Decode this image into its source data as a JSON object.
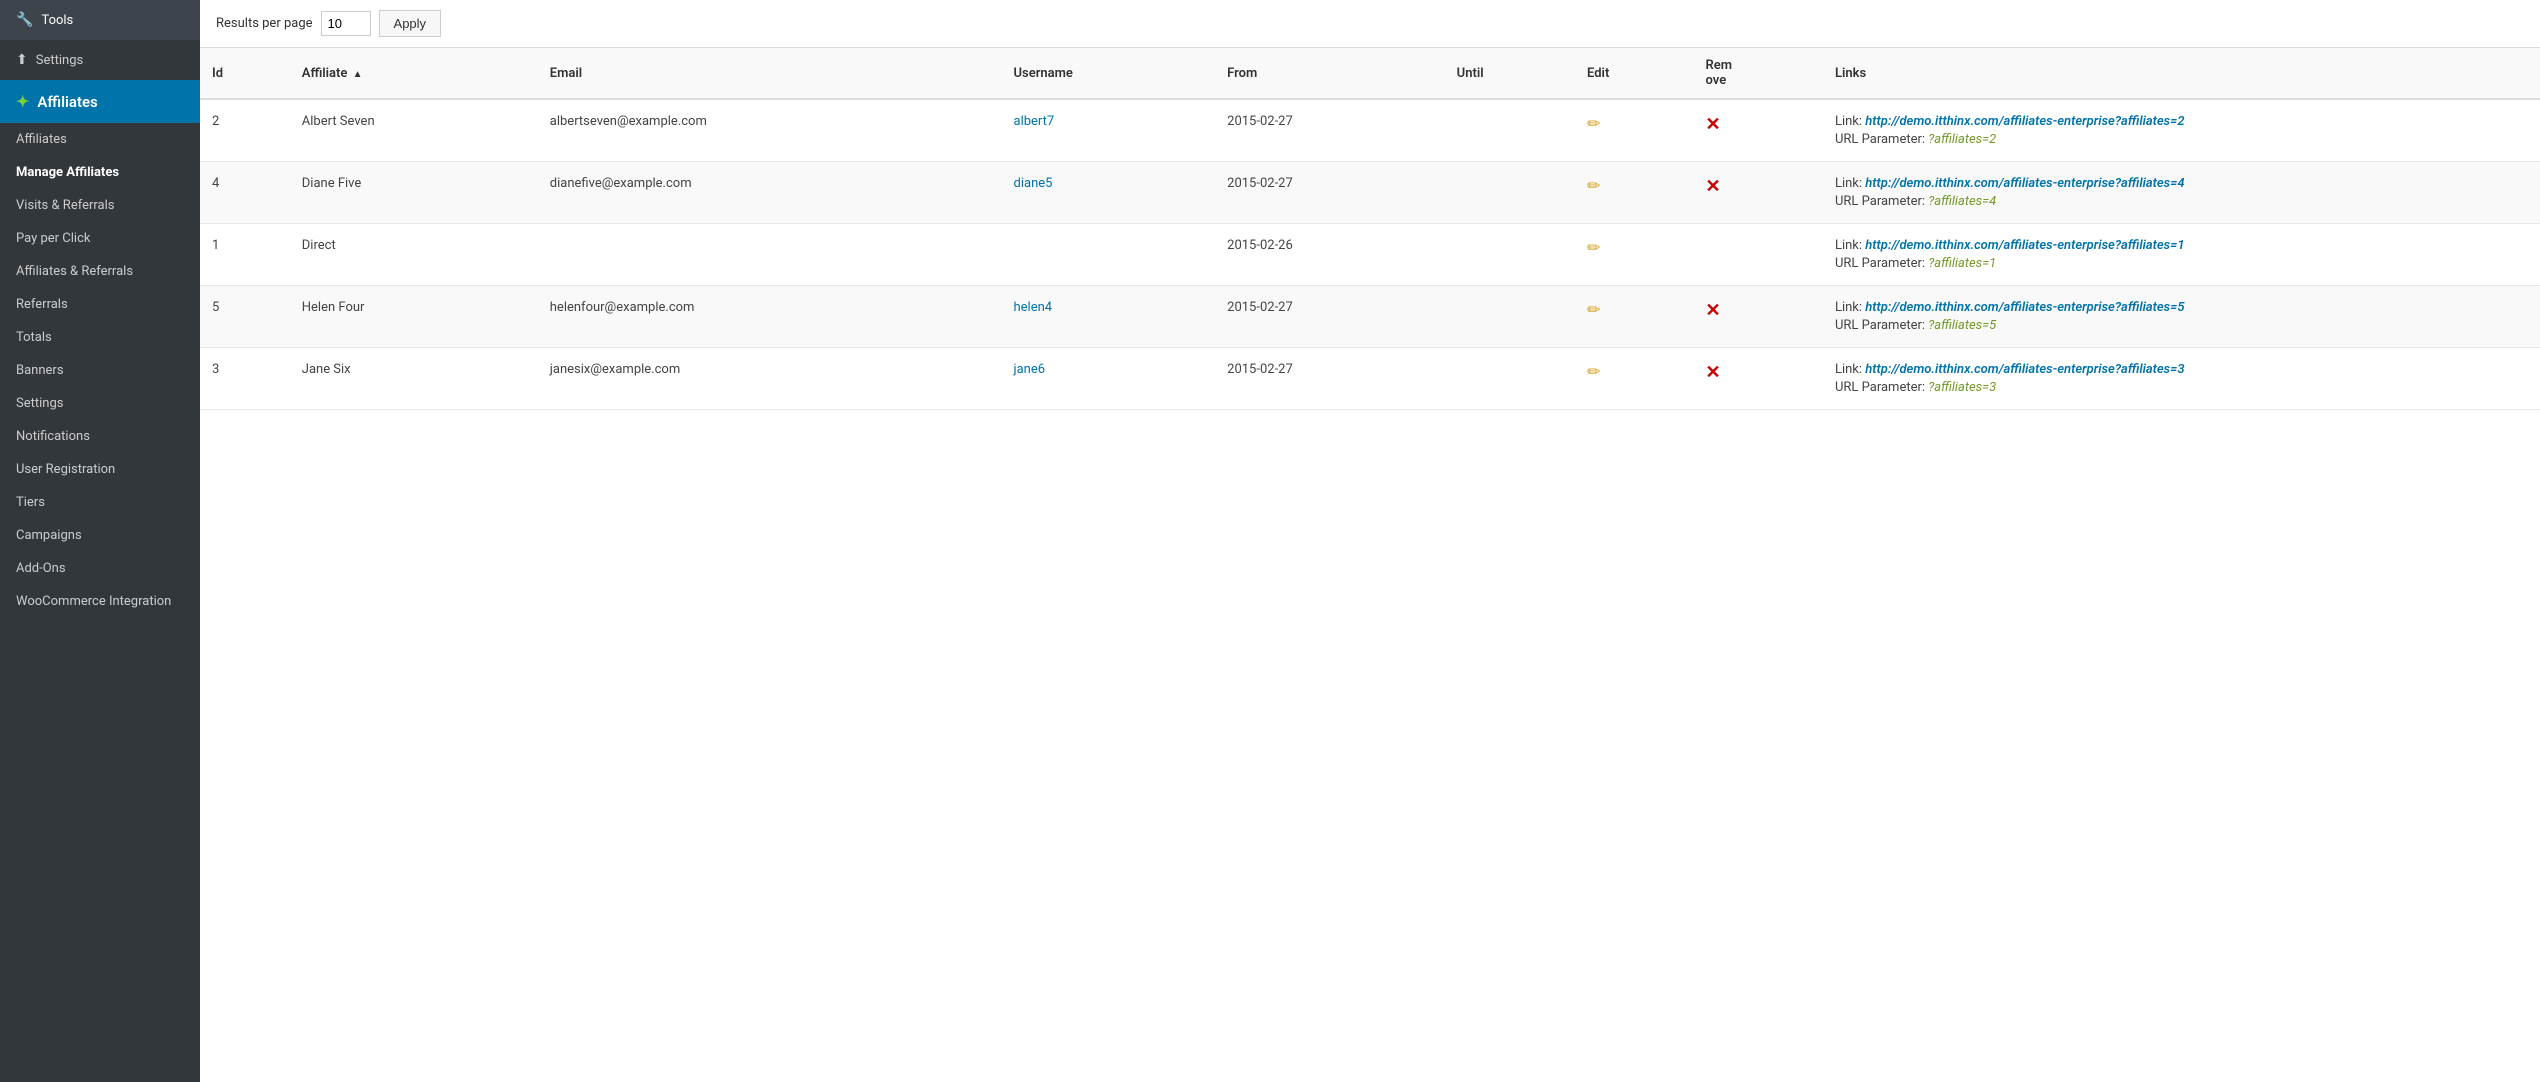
{
  "sidebar": {
    "top_items": [
      {
        "id": "tools",
        "label": "Tools",
        "icon": "🔧"
      },
      {
        "id": "settings",
        "label": "Settings",
        "icon": "⬆"
      }
    ],
    "active_section": "Affiliates",
    "sub_items": [
      {
        "id": "affiliates",
        "label": "Affiliates",
        "active": false
      },
      {
        "id": "manage-affiliates",
        "label": "Manage Affiliates",
        "active": true
      },
      {
        "id": "visits-referrals",
        "label": "Visits & Referrals",
        "active": false
      },
      {
        "id": "pay-per-click",
        "label": "Pay per Click",
        "active": false
      },
      {
        "id": "affiliates-referrals",
        "label": "Affiliates & Referrals",
        "active": false
      },
      {
        "id": "referrals",
        "label": "Referrals",
        "active": false
      },
      {
        "id": "totals",
        "label": "Totals",
        "active": false
      },
      {
        "id": "banners",
        "label": "Banners",
        "active": false
      },
      {
        "id": "settings",
        "label": "Settings",
        "active": false
      },
      {
        "id": "notifications",
        "label": "Notifications",
        "active": false
      },
      {
        "id": "user-registration",
        "label": "User Registration",
        "active": false
      },
      {
        "id": "tiers",
        "label": "Tiers",
        "active": false
      },
      {
        "id": "campaigns",
        "label": "Campaigns",
        "active": false
      },
      {
        "id": "add-ons",
        "label": "Add-Ons",
        "active": false
      },
      {
        "id": "woocommerce-integration",
        "label": "WooCommerce Integration",
        "active": false
      }
    ]
  },
  "toolbar": {
    "results_per_page_label": "Results per page",
    "results_per_page_value": "10",
    "apply_label": "Apply"
  },
  "table": {
    "columns": [
      {
        "id": "id",
        "label": "Id",
        "sortable": false
      },
      {
        "id": "affiliate",
        "label": "Affiliate",
        "sortable": true,
        "sort_direction": "asc"
      },
      {
        "id": "email",
        "label": "Email",
        "sortable": false
      },
      {
        "id": "username",
        "label": "Username",
        "sortable": false
      },
      {
        "id": "from",
        "label": "From",
        "sortable": false
      },
      {
        "id": "until",
        "label": "Until",
        "sortable": false
      },
      {
        "id": "edit",
        "label": "Edit",
        "sortable": false
      },
      {
        "id": "remove",
        "label": "Remove",
        "sortable": false
      },
      {
        "id": "links",
        "label": "Links",
        "sortable": false
      }
    ],
    "rows": [
      {
        "id": "2",
        "affiliate": "Albert Seven",
        "email": "albertseven@example.com",
        "username": "albert7",
        "from": "2015-02-27",
        "until": "",
        "link_url": "http://demo.itthinx.com/affiliates-enterprise?affiliates=2",
        "link_display": "http://demo.itthinx.com/affiliates-enterprise?affiliates=2",
        "url_param": "?affiliates=2",
        "has_remove": true
      },
      {
        "id": "4",
        "affiliate": "Diane Five",
        "email": "dianefive@example.com",
        "username": "diane5",
        "from": "2015-02-27",
        "until": "",
        "link_url": "http://demo.itthinx.com/affiliates-enterprise?affiliates=4",
        "link_display": "http://demo.itthinx.com/affiliates-enterprise?affiliates=4",
        "url_param": "?affiliates=4",
        "has_remove": true
      },
      {
        "id": "1",
        "affiliate": "Direct",
        "email": "",
        "username": "",
        "from": "2015-02-26",
        "until": "",
        "link_url": "http://demo.itthinx.com/affiliates-enterprise?affiliates=1",
        "link_display": "http://demo.itthinx.com/affiliates-enterprise?affiliates=1",
        "url_param": "?affiliates=1",
        "has_remove": false
      },
      {
        "id": "5",
        "affiliate": "Helen Four",
        "email": "helenfour@example.com",
        "username": "helen4",
        "from": "2015-02-27",
        "until": "",
        "link_url": "http://demo.itthinx.com/affiliates-enterprise?affiliates=5",
        "link_display": "http://demo.itthinx.com/affiliates-enterprise?affiliates=5",
        "url_param": "?affiliates=5",
        "has_remove": true
      },
      {
        "id": "3",
        "affiliate": "Jane Six",
        "email": "janesix@example.com",
        "username": "jane6",
        "from": "2015-02-27",
        "until": "",
        "link_url": "http://demo.itthinx.com/affiliates-enterprise?affiliates=3",
        "link_display": "http://demo.itthinx.com/affiliates-enterprise?affiliates=3",
        "url_param": "?affiliates=3",
        "has_remove": true
      }
    ]
  }
}
